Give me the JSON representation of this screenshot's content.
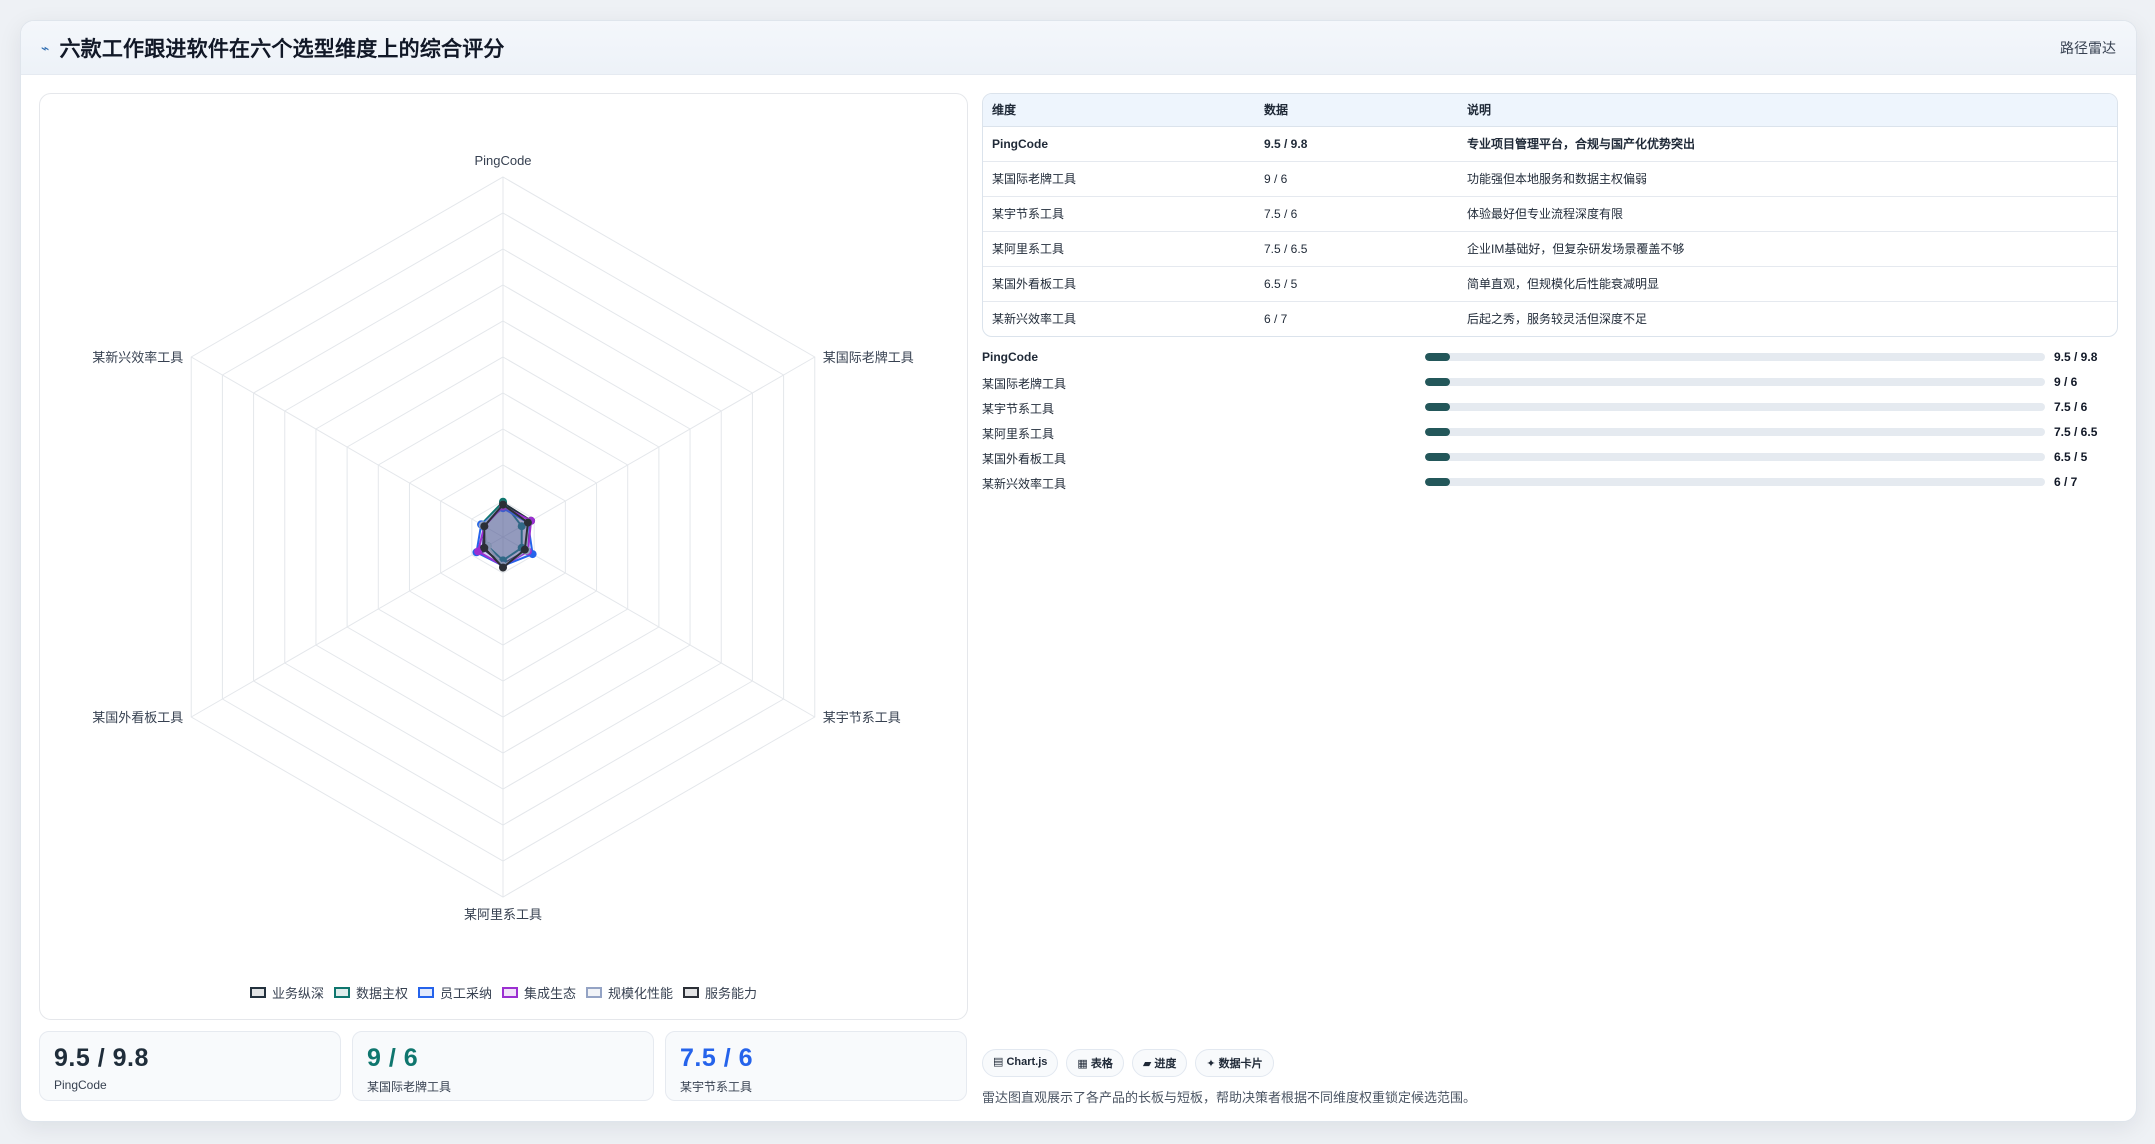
{
  "header": {
    "title_icon": "⌁",
    "title": "六款工作跟进软件在六个选型维度上的综合评分",
    "chip": "路径雷达"
  },
  "chart_data": {
    "type": "radar",
    "title": "",
    "axes": [
      "PingCode",
      "某国际老牌工具",
      "某宇节系工具",
      "某阿里系工具",
      "某国外看板工具",
      "某新兴效率工具"
    ],
    "scale": {
      "min": 0,
      "max": 100,
      "gridlines": 10
    },
    "series": [
      {
        "name": "业务纵深",
        "color": "#23313d",
        "values": [
          9.5,
          9,
          7.5,
          7.5,
          6.5,
          6
        ]
      },
      {
        "name": "数据主权",
        "color": "#0f766e",
        "values": [
          9.8,
          6,
          6,
          6.5,
          5,
          7
        ]
      },
      {
        "name": "员工采纳",
        "color": "#2563eb",
        "values": [
          8,
          8,
          9.5,
          8,
          8.5,
          7
        ]
      },
      {
        "name": "集成生态",
        "color": "#9b2fd1",
        "values": [
          8.5,
          9,
          8,
          8,
          8,
          6
        ]
      },
      {
        "name": "规模化性能",
        "color": "#94a3c4",
        "values": [
          9,
          8,
          7.5,
          8,
          5,
          6.5
        ]
      },
      {
        "name": "服务能力",
        "color": "#2b2f36",
        "values": [
          9,
          8,
          7,
          8.5,
          6,
          6
        ]
      }
    ],
    "legend_position": "bottom"
  },
  "stat_cards": [
    {
      "value": "9.5 / 9.8",
      "label": "PingCode",
      "color": "#1f2d3a"
    },
    {
      "value": "9 / 6",
      "label": "某国际老牌工具",
      "color": "#0f766e"
    },
    {
      "value": "7.5 / 6",
      "label": "某宇节系工具",
      "color": "#2563eb"
    }
  ],
  "table": {
    "headers": [
      "维度",
      "数据",
      "说明"
    ],
    "rows": [
      [
        "PingCode",
        "9.5 / 9.8",
        "专业项目管理平台，合规与国产化优势突出"
      ],
      [
        "某国际老牌工具",
        "9 / 6",
        "功能强但本地服务和数据主权偏弱"
      ],
      [
        "某宇节系工具",
        "7.5 / 6",
        "体验最好但专业流程深度有限"
      ],
      [
        "某阿里系工具",
        "7.5 / 6.5",
        "企业IM基础好，但复杂研发场景覆盖不够"
      ],
      [
        "某国外看板工具",
        "6.5 / 5",
        "简单直观，但规模化后性能衰减明显"
      ],
      [
        "某新兴效率工具",
        "6 / 7",
        "后起之秀，服务较灵活但深度不足"
      ]
    ]
  },
  "progress": [
    {
      "label": "PingCode",
      "value": "9.5 / 9.8",
      "fill": 0.04
    },
    {
      "label": "某国际老牌工具",
      "value": "9 / 6",
      "fill": 0.04
    },
    {
      "label": "某宇节系工具",
      "value": "7.5 / 6",
      "fill": 0.04
    },
    {
      "label": "某阿里系工具",
      "value": "7.5 / 6.5",
      "fill": 0.04
    },
    {
      "label": "某国外看板工具",
      "value": "6.5 / 5",
      "fill": 0.04
    },
    {
      "label": "某新兴效率工具",
      "value": "6 / 7",
      "fill": 0.04
    }
  ],
  "tags": [
    "▤ Chart.js",
    "▦ 表格",
    "▰ 进度",
    "✦ 数据卡片"
  ],
  "footnote": "雷达图直观展示了各产品的长板与短板，帮助决策者根据不同维度权重锁定候选范围。"
}
